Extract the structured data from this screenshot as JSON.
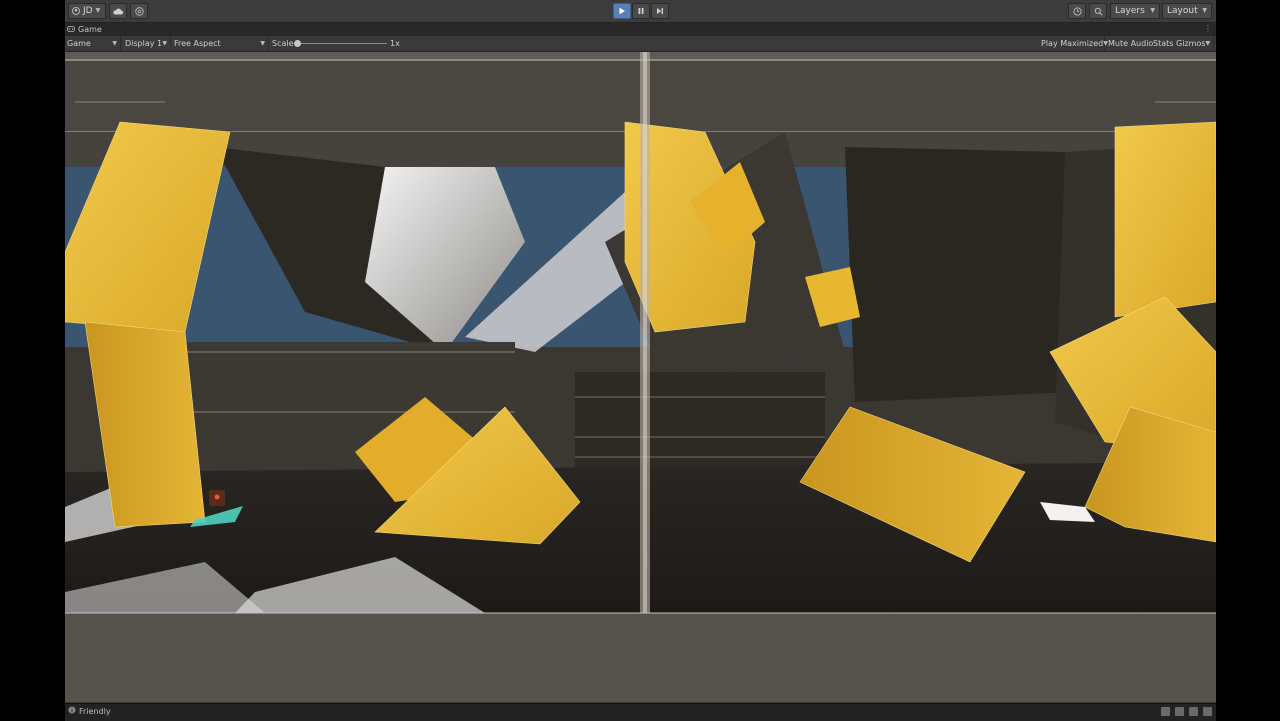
{
  "toolbar": {
    "account_label": "JD",
    "layers_label": "Layers",
    "layout_label": "Layout"
  },
  "game_tab": {
    "title": "Game"
  },
  "game_toolbar": {
    "mode_label": "Game",
    "display_label": "Display 1",
    "aspect_label": "Free Aspect",
    "scale_label": "Scale",
    "scale_value": "1x",
    "scale_slider_level": 0,
    "play_mode_label": "Play Maximized",
    "mute_label": "Mute Audio",
    "stats_label": "Stats",
    "gizmos_label": "Gizmos"
  },
  "status_bar": {
    "message": "Friendly"
  },
  "colors": {
    "play_active": "#5a7fb5",
    "gold_block": "#e8b832",
    "dark_wall": "#2f2b27",
    "sky": "#3a5570"
  },
  "icons": [
    "account-icon",
    "cloud-icon",
    "collab-icon",
    "play-icon",
    "pause-icon",
    "step-icon",
    "history-icon",
    "search-icon",
    "game-tab-icon",
    "menu-icon",
    "status-info-icon"
  ]
}
